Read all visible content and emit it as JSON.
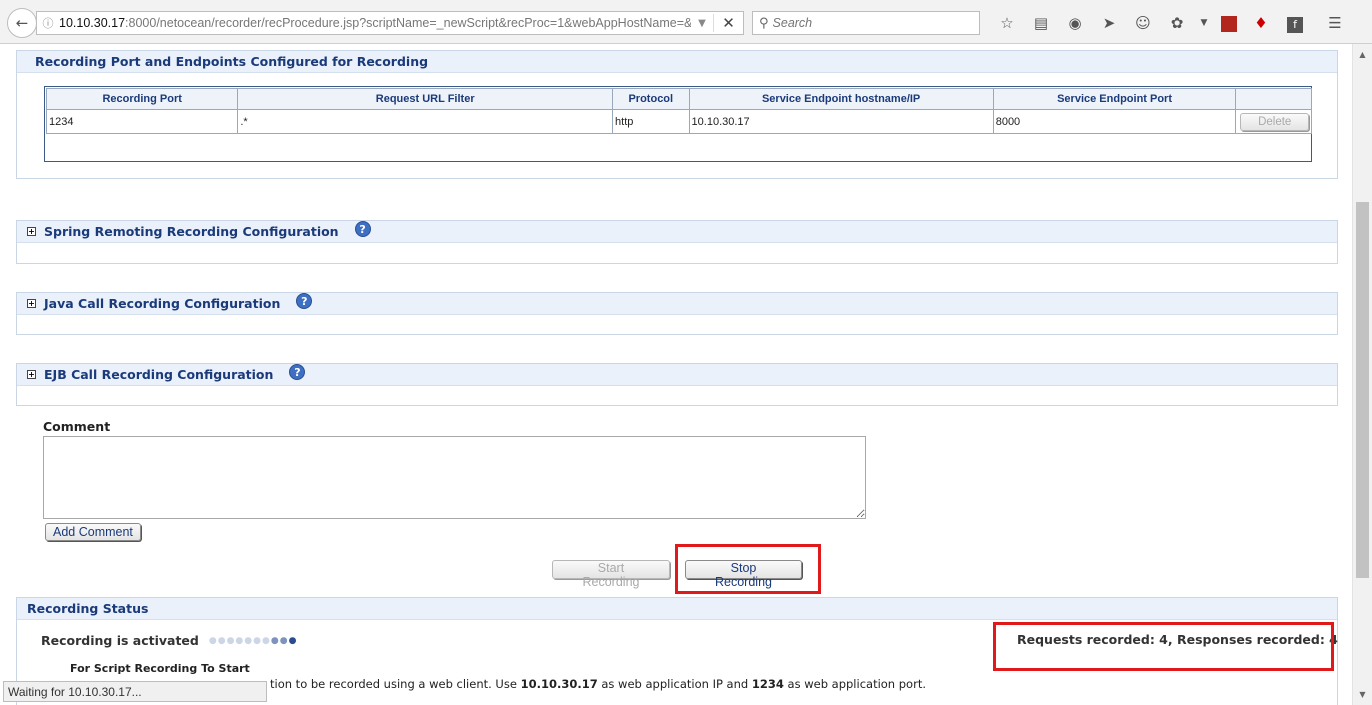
{
  "browser": {
    "url_host": "10.10.30.17",
    "url_rest": ":8000/netocean/recorder/recProcedure.jsp?scriptName=_newScript&recProc=1&webAppHostName=&w",
    "search_placeholder": "Search"
  },
  "recording_ports": {
    "title": "Recording Port and Endpoints Configured for Recording",
    "columns": [
      "Recording Port",
      "Request URL Filter",
      "Protocol",
      "Service Endpoint hostname/IP",
      "Service Endpoint Port",
      ""
    ],
    "rows": [
      {
        "port": "1234",
        "filter": ".*",
        "protocol": "http",
        "host": "10.10.30.17",
        "endpoint_port": "8000",
        "delete_label": "Delete"
      }
    ]
  },
  "sections": {
    "spring": "Spring Remoting Recording Configuration",
    "java": "Java Call Recording Configuration",
    "ejb": "EJB Call Recording Configuration"
  },
  "comment": {
    "label": "Comment",
    "value": "",
    "add_label": "Add Comment"
  },
  "controls": {
    "start_label": "Start Recording",
    "stop_label": "Stop Recording"
  },
  "status": {
    "title": "Recording Status",
    "activated": "Recording is activated",
    "counts": "Requests recorded: 4, Responses recorded: 4",
    "script_heading": "For Script Recording To Start",
    "instr_pre": "tion to be recorded using a web client. Use ",
    "instr_ip": "10.10.30.17",
    "instr_mid": " as web application IP and ",
    "instr_port": "1234",
    "instr_post": " as web application port."
  },
  "status_bar": "Waiting for 10.10.30.17...",
  "colors": {
    "accent": "#1a3a7a",
    "highlight": "#e01a1a",
    "panel_head": "#eaf1fb"
  }
}
